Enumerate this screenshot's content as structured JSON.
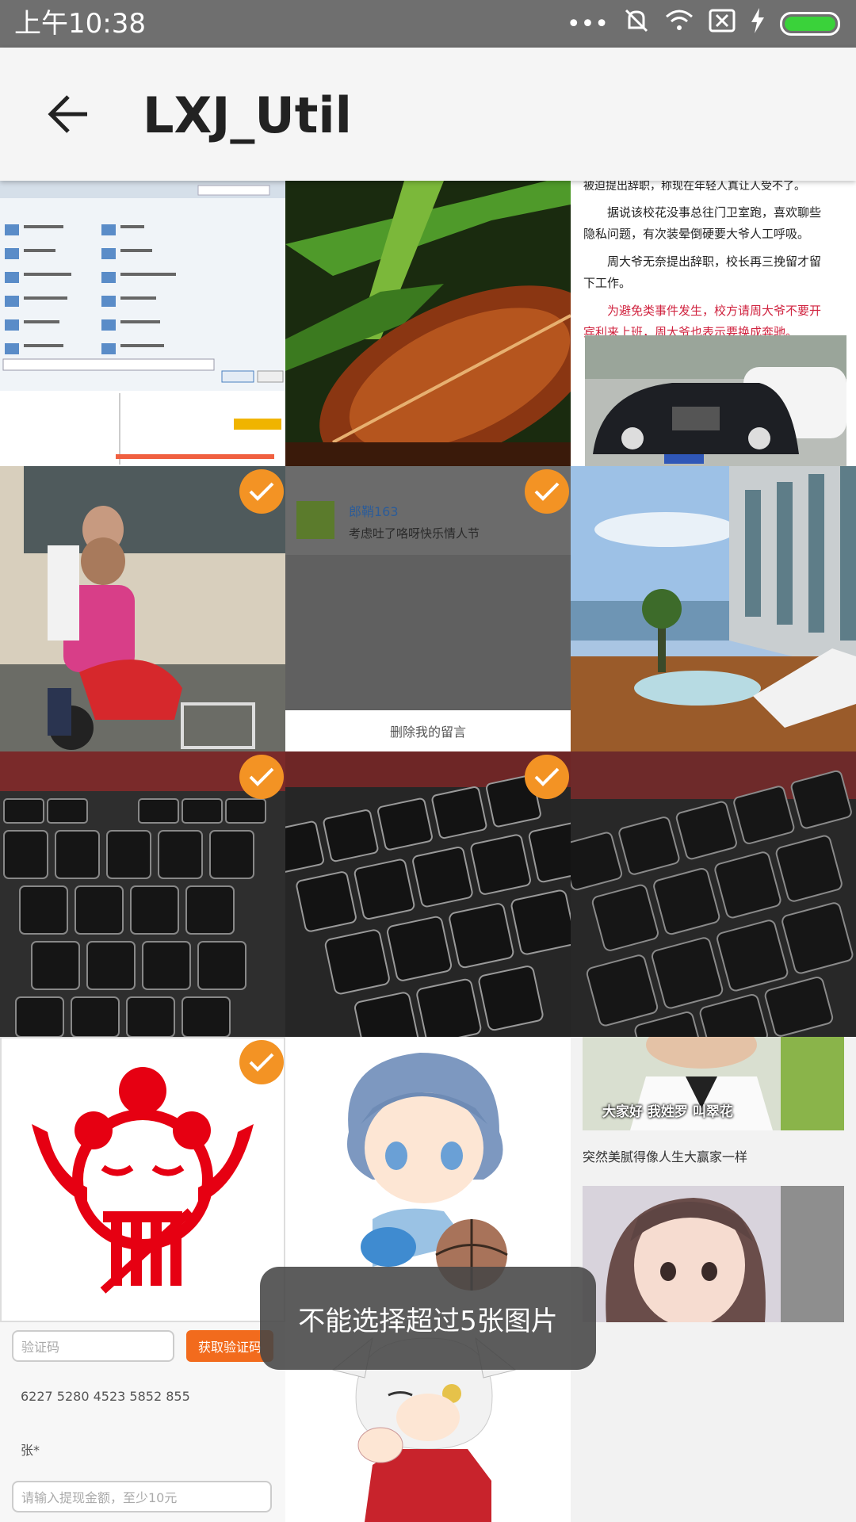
{
  "status_bar": {
    "time": "上午10:38",
    "icons": [
      "more-dots-icon",
      "mute-icon",
      "wifi-icon",
      "sim-off-icon",
      "charging-icon",
      "battery-icon"
    ]
  },
  "app_bar": {
    "back_icon": "arrow-back-icon",
    "title": "LXJ_Util"
  },
  "grid": {
    "columns": 3,
    "rows": [
      [
        {
          "name": "photo-screenshot-file-dialog",
          "selected": false
        },
        {
          "name": "photo-autumn-leaf",
          "selected": false
        },
        {
          "name": "photo-news-article-car",
          "selected": false
        }
      ],
      [
        {
          "name": "photo-bus-motorcycle",
          "selected": true
        },
        {
          "name": "photo-comment-screenshot",
          "selected": true
        },
        {
          "name": "photo-hotel-pool",
          "selected": false
        }
      ],
      [
        {
          "name": "photo-keyboard-1",
          "selected": true
        },
        {
          "name": "photo-keyboard-2",
          "selected": true
        },
        {
          "name": "photo-keyboard-3",
          "selected": false
        }
      ],
      [
        {
          "name": "photo-red-logo",
          "selected": true
        },
        {
          "name": "photo-anime-basketball",
          "selected": false
        },
        {
          "name": "photo-girl-collage",
          "selected": false
        }
      ]
    ],
    "comment_screenshot": {
      "username": "郎鞘163",
      "message": "考虑吐了咯呀快乐情人节",
      "delete_label": "删除我的留言"
    },
    "news_screenshot": {
      "lines": [
        "被迫提出辞职，称现在年轻人真让人受不了。",
        "据说该校花没事总往门卫室跑，喜欢聊些",
        "隐私问题，有次装晕倒硬要大爷人工呼吸。",
        "周大爷无奈提出辞职，校长再三挽留才留",
        "下工作。",
        "为避免类事件发生，校方请周大爷不要开",
        "宾利来上班，周大爷也表示要换成奔驰。"
      ]
    },
    "girl_collage": {
      "subtitle": "大家好 我姓罗 叫翠花",
      "caption": "突然美腻得像人生大赢家一样"
    },
    "form_screenshot": {
      "code_placeholder": "验证码",
      "get_code_label": "获取验证码",
      "card_number": "6227 5280 4523 5852 855",
      "name": "张*",
      "amount_placeholder": "请输入提现金额，至少10元"
    }
  },
  "toast": {
    "message": "不能选择超过5张图片"
  },
  "colors": {
    "status_bar_bg": "#6f6f6f",
    "app_bar_bg": "#f5f5f5",
    "check_badge": "#f39324",
    "battery": "#3ad23a"
  }
}
